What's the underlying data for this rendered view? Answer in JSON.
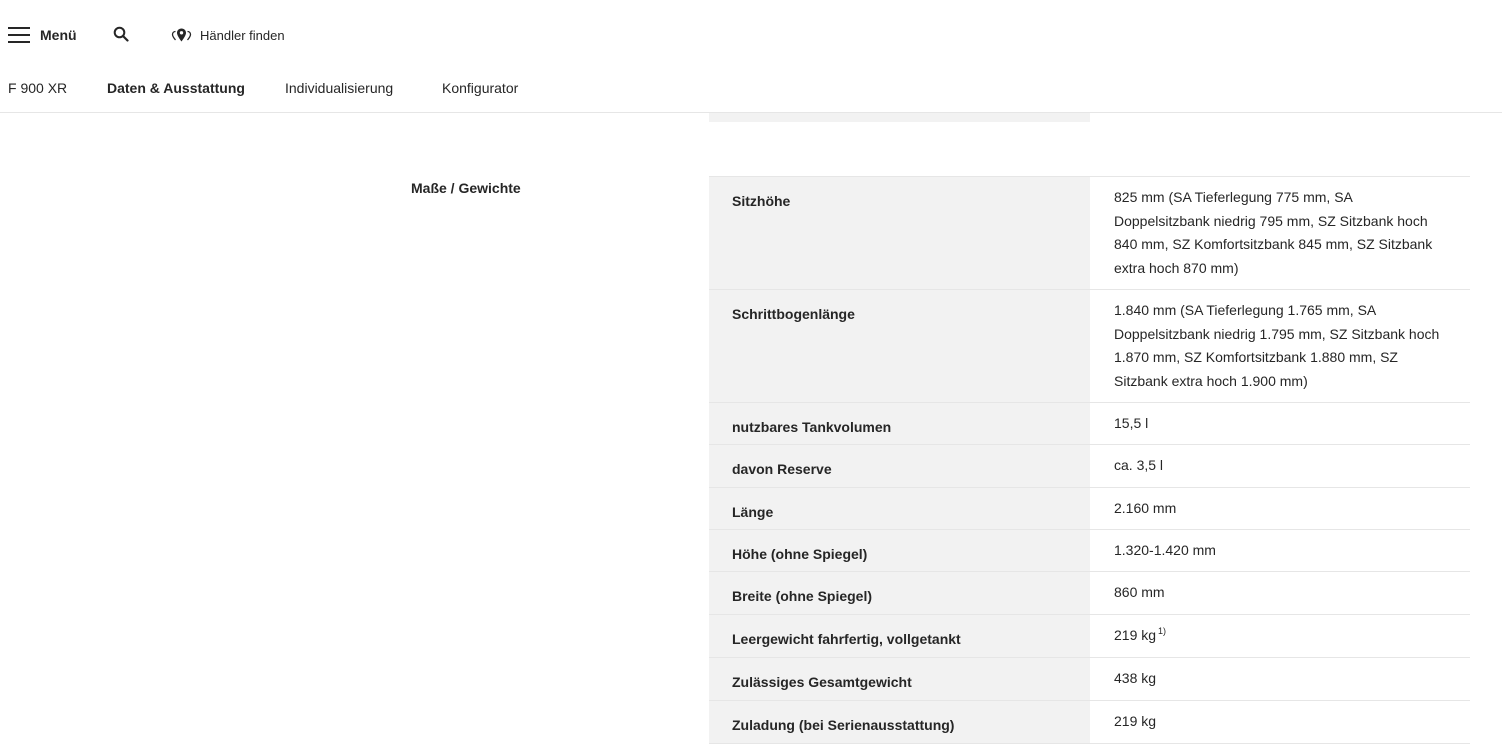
{
  "header": {
    "menu_label": "Menü",
    "dealer_label": "Händler finden"
  },
  "subnav": {
    "model": "F 900 XR",
    "tabs": [
      "Daten & Ausstattung",
      "Individualisierung",
      "Konfigurator"
    ]
  },
  "section": {
    "title": "Maße / Gewichte"
  },
  "specs": [
    {
      "label": "Sitzhöhe",
      "value": "825 mm (SA Tieferlegung 775 mm, SA Doppelsitzbank niedrig 795 mm, SZ Sitzbank hoch 840 mm, SZ Komfortsitzbank 845 mm, SZ Sitzbank extra hoch 870 mm)"
    },
    {
      "label": "Schrittbogenlänge",
      "value": "1.840 mm (SA Tieferlegung 1.765 mm, SA Doppelsitzbank niedrig 1.795 mm, SZ Sitzbank hoch 1.870 mm, SZ Komfortsitzbank 1.880 mm, SZ Sitzbank extra hoch 1.900 mm)"
    },
    {
      "label": "nutzbares Tankvolumen",
      "value": "15,5 l"
    },
    {
      "label": "davon Reserve",
      "value": "ca. 3,5 l"
    },
    {
      "label": "Länge",
      "value": "2.160 mm"
    },
    {
      "label": "Höhe (ohne Spiegel)",
      "value": "1.320-1.420 mm"
    },
    {
      "label": "Breite (ohne Spiegel)",
      "value": "860 mm"
    },
    {
      "label": "Leergewicht fahrfertig, vollgetankt",
      "value": "219 kg",
      "footnote": "1)"
    },
    {
      "label": "Zulässiges Gesamtgewicht",
      "value": "438 kg"
    },
    {
      "label": "Zuladung (bei Serienausstattung)",
      "value": "219 kg"
    }
  ]
}
